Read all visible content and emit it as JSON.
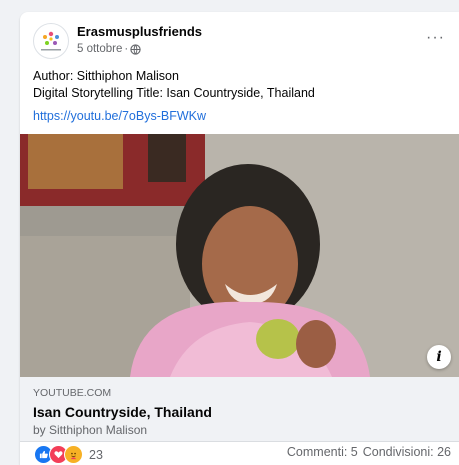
{
  "post": {
    "page_name": "Erasmusplusfriends",
    "date": "5 ottobre",
    "separator": "·",
    "text_lines": [
      "Author: Sitthiphon Malison",
      "Digital Storytelling Title: Isan Countryside, Thailand"
    ],
    "link": "https://youtu.be/7oBys-BFWKw",
    "more_glyph": "···"
  },
  "preview": {
    "info_glyph": "i",
    "domain": "YOUTUBE.COM",
    "title": "Isan Countryside, Thailand",
    "subtitle": "by Sitthiphon Malison"
  },
  "footer": {
    "reaction_count": "23",
    "reaction_icons": [
      "like-icon",
      "love-icon",
      "care-icon"
    ],
    "comments": "Commenti: 5",
    "shares": "Condivisioni: 26"
  },
  "colors": {
    "link": "#216fdb",
    "like": "#1877f2",
    "love": "#f33e58",
    "care": "#f7b125"
  }
}
